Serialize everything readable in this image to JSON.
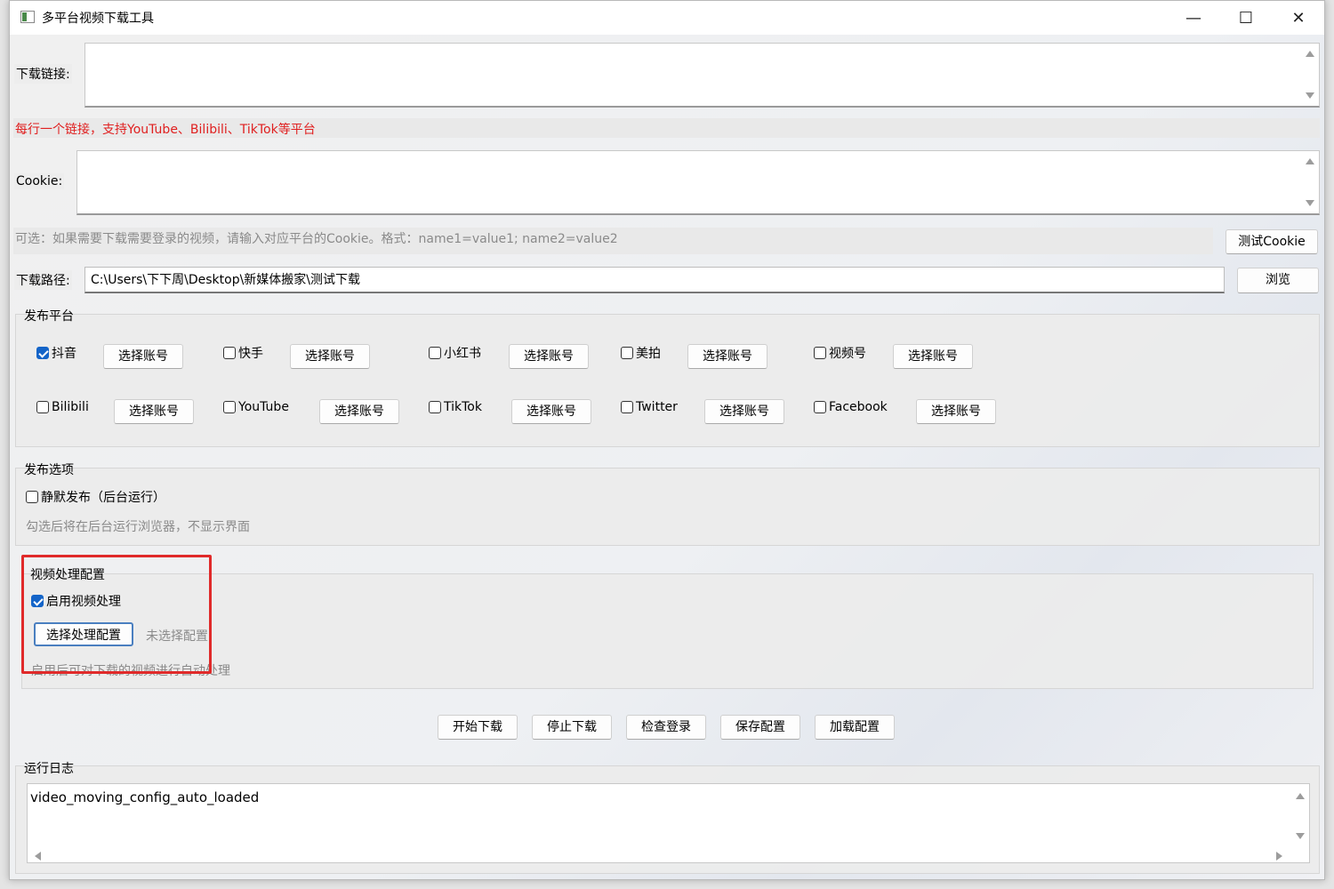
{
  "window": {
    "title": "多平台视频下载工具",
    "minimize_glyph": "—",
    "maximize_glyph": "☐",
    "close_glyph": "✕"
  },
  "download": {
    "links_label": "下载链接:",
    "links_value": "",
    "links_hint": "每行一个链接，支持YouTube、Bilibili、TikTok等平台",
    "cookie_label": "Cookie:",
    "cookie_value": "",
    "cookie_hint": "可选：如果需要下载需要登录的视频，请输入对应平台的Cookie。格式：name1=value1; name2=value2",
    "test_cookie_button": "测试Cookie",
    "path_label": "下载路径:",
    "path_value": "C:\\Users\\下下周\\Desktop\\新媒体搬家\\测试下载",
    "browse_button": "浏览"
  },
  "platforms": {
    "title": "发布平台",
    "account_button": "选择账号",
    "items": [
      {
        "label": "抖音",
        "checked": true
      },
      {
        "label": "快手",
        "checked": false
      },
      {
        "label": "小红书",
        "checked": false
      },
      {
        "label": "美拍",
        "checked": false
      },
      {
        "label": "视频号",
        "checked": false
      },
      {
        "label": "Bilibili",
        "checked": false
      },
      {
        "label": "YouTube",
        "checked": false
      },
      {
        "label": "TikTok",
        "checked": false
      },
      {
        "label": "Twitter",
        "checked": false
      },
      {
        "label": "Facebook",
        "checked": false
      }
    ]
  },
  "publish_options": {
    "title": "发布选项",
    "silent_label": "静默发布（后台运行）",
    "silent_checked": false,
    "silent_hint": "勾选后将在后台运行浏览器，不显示界面"
  },
  "video_processing": {
    "title": "视频处理配置",
    "enable_label": "启用视频处理",
    "enable_checked": true,
    "select_button": "选择处理配置",
    "status": "未选择配置",
    "hint": "启用后可对下载的视频进行自动处理"
  },
  "actions": {
    "start": "开始下载",
    "stop": "停止下载",
    "check_login": "检查登录",
    "save_config": "保存配置",
    "load_config": "加载配置"
  },
  "log": {
    "title": "运行日志",
    "lines": "video_moving_config_auto_loaded"
  },
  "colors": {
    "hint_red": "#e02020",
    "highlight_box": "#e02a2a",
    "checkbox_checked": "#1464c8"
  }
}
